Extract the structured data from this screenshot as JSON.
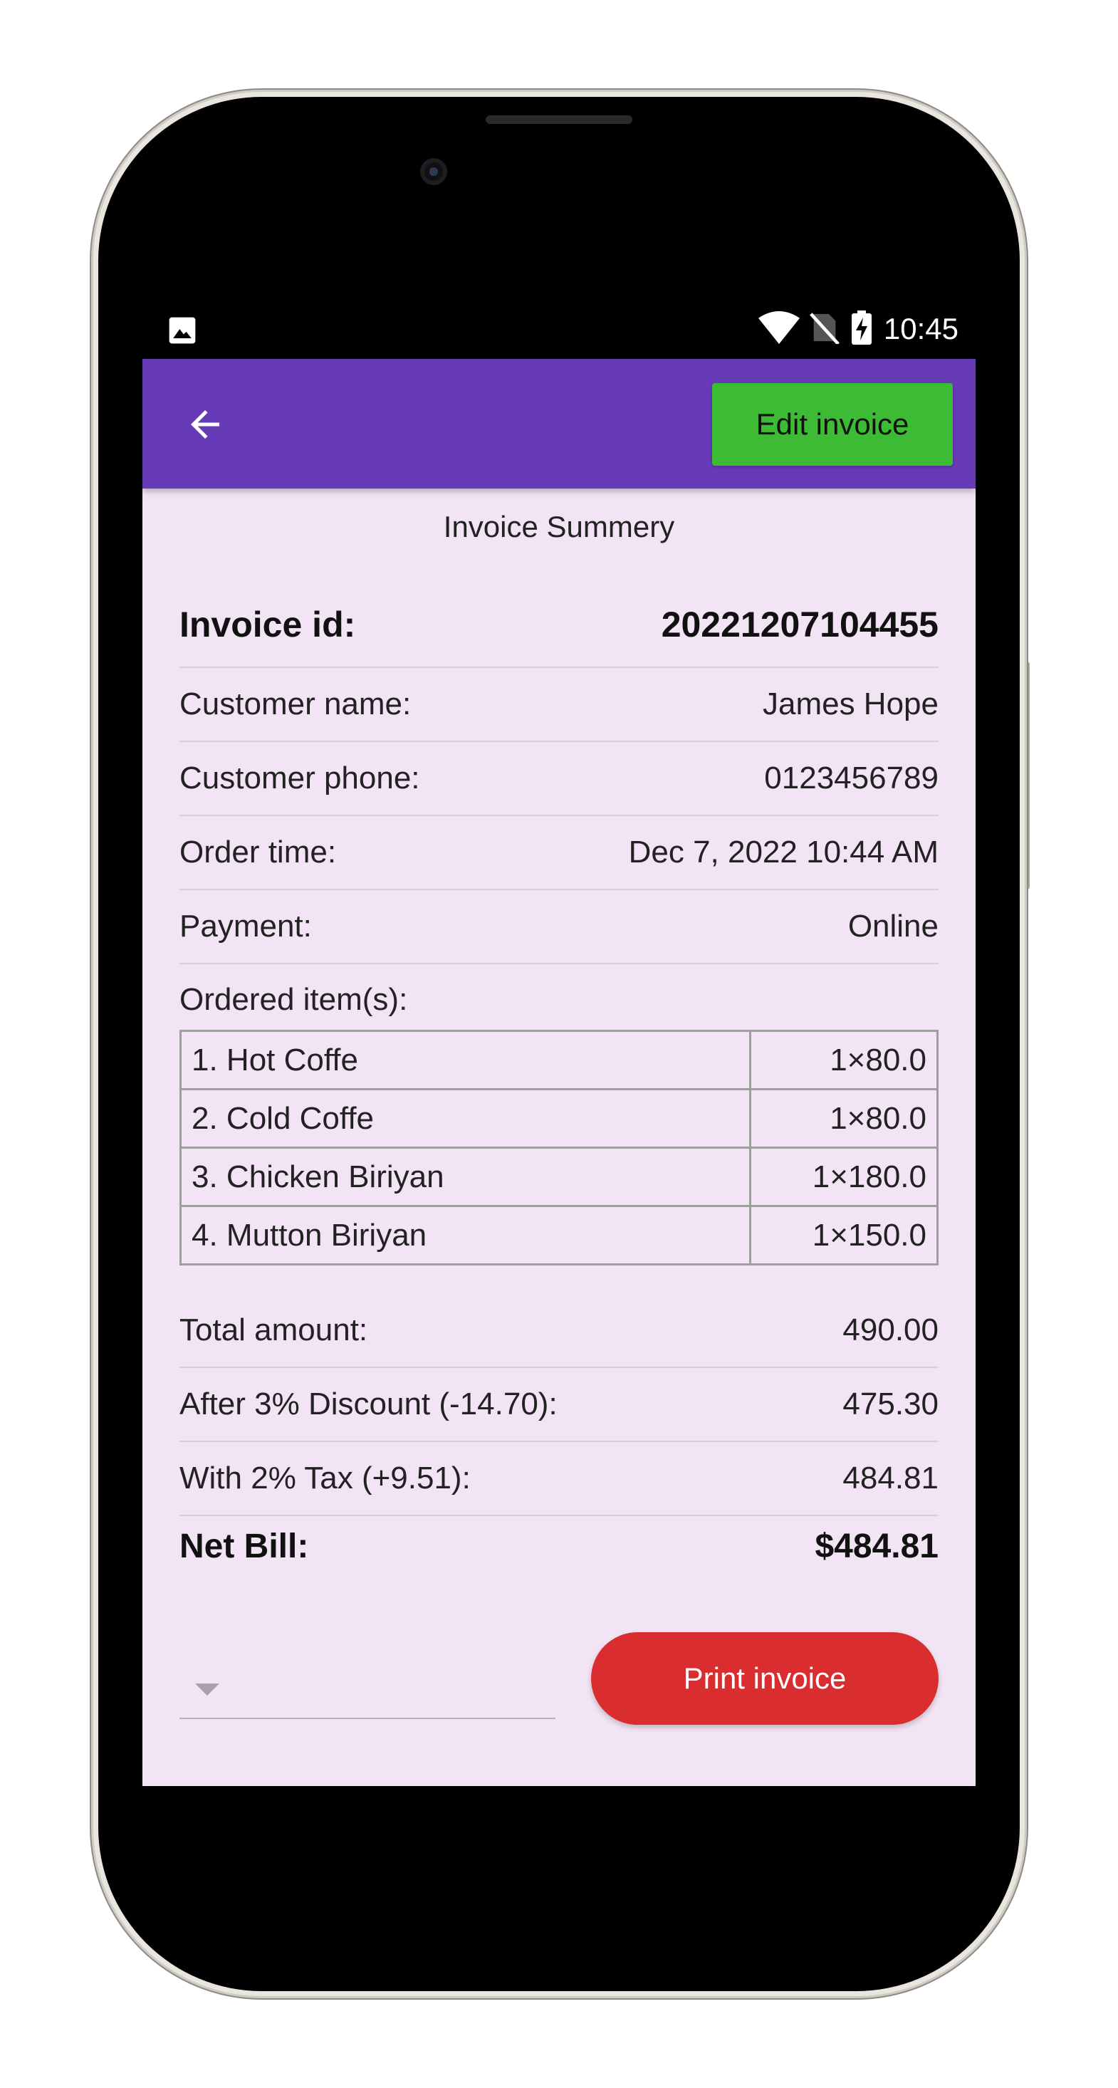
{
  "status_bar": {
    "time": "10:45"
  },
  "app_bar": {
    "edit_label": "Edit invoice",
    "brand_color": "#673ab7",
    "edit_color": "#3dbb34"
  },
  "invoice": {
    "title": "Invoice Summery",
    "id_label": "Invoice id:",
    "id_value": "20221207104455",
    "rows": [
      {
        "label": "Customer name:",
        "value": "James Hope"
      },
      {
        "label": "Customer phone:",
        "value": "0123456789"
      },
      {
        "label": "Order time:",
        "value": "Dec 7, 2022 10:44 AM"
      },
      {
        "label": "Payment:",
        "value": "Online"
      }
    ],
    "items_label": "Ordered item(s):",
    "items": [
      {
        "name": "1. Hot Coffe",
        "qty": "1×80.0"
      },
      {
        "name": "2. Cold Coffe",
        "qty": "1×80.0"
      },
      {
        "name": "3. Chicken Biriyan",
        "qty": "1×180.0"
      },
      {
        "name": "4. Mutton Biriyan",
        "qty": "1×150.0"
      }
    ],
    "totals": [
      {
        "label": "Total amount:",
        "value": "490.00"
      },
      {
        "label": "After 3% Discount (-14.70):",
        "value": "475.30"
      },
      {
        "label": "With 2% Tax (+9.51):",
        "value": "484.81"
      }
    ],
    "net_label": "Net Bill:",
    "net_value": "$484.81"
  },
  "footer": {
    "print_label": "Print invoice",
    "print_color": "#d92d2f"
  }
}
